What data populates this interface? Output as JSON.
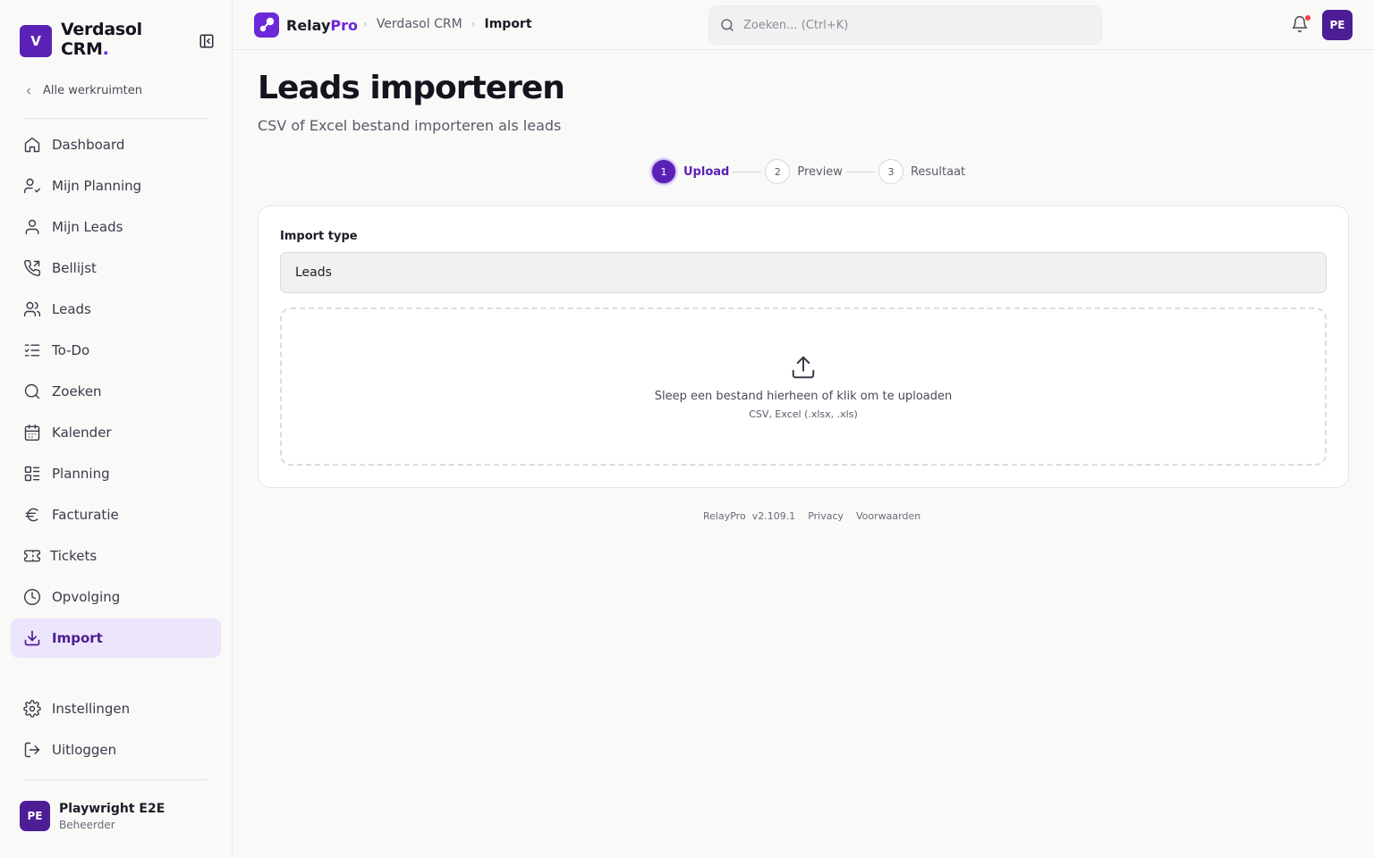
{
  "workspace": {
    "initial": "V",
    "name_line1": "Verdasol",
    "name_line2": "CRM",
    "name_dot": "."
  },
  "sidebar": {
    "back_label": "Alle werkruimten",
    "items": [
      {
        "label": "Dashboard",
        "icon": "home-icon"
      },
      {
        "label": "Mijn Planning",
        "icon": "user-check-icon"
      },
      {
        "label": "Mijn Leads",
        "icon": "user-icon"
      },
      {
        "label": "Bellijst",
        "icon": "phone-icon"
      },
      {
        "label": "Leads",
        "icon": "users-icon"
      },
      {
        "label": "To-Do",
        "icon": "list-checks-icon"
      },
      {
        "label": "Zoeken",
        "icon": "search-icon"
      },
      {
        "label": "Kalender",
        "icon": "calendar-icon"
      },
      {
        "label": "Planning",
        "icon": "layout-list-icon"
      },
      {
        "label": "Facturatie",
        "icon": "euro-icon"
      },
      {
        "label": "Tickets",
        "icon": "ticket-icon"
      },
      {
        "label": "Opvolging",
        "icon": "clock-icon"
      },
      {
        "label": "Import",
        "icon": "download-icon",
        "active": true
      }
    ],
    "bottom_items": [
      {
        "label": "Instellingen",
        "icon": "gear-icon"
      },
      {
        "label": "Uitloggen",
        "icon": "logout-icon"
      }
    ],
    "user": {
      "initials": "PE",
      "name": "Playwright E2E",
      "role": "Beheerder"
    }
  },
  "topbar": {
    "brand_main": "Relay",
    "brand_accent": "Pro",
    "breadcrumbs": [
      "Verdasol CRM",
      "Import"
    ],
    "search_placeholder": "Zoeken... (Ctrl+K)",
    "user_initials": "PE"
  },
  "page": {
    "title": "Leads importeren",
    "subtitle": "CSV of Excel bestand importeren als leads"
  },
  "stepper": [
    {
      "number": "1",
      "label": "Upload",
      "active": true
    },
    {
      "number": "2",
      "label": "Preview",
      "active": false
    },
    {
      "number": "3",
      "label": "Resultaat",
      "active": false
    }
  ],
  "import_form": {
    "type_label": "Import type",
    "type_value": "Leads",
    "dropzone_text": "Sleep een bestand hierheen of klik om te uploaden",
    "dropzone_hint": "CSV, Excel (.xlsx, .xls)"
  },
  "footer": {
    "app": "RelayPro",
    "version": "v2.109.1",
    "privacy": "Privacy",
    "terms": "Voorwaarden"
  },
  "colors": {
    "accent": "#5b21b6",
    "active_bg": "#ede5fb",
    "notification": "#ef4444"
  }
}
